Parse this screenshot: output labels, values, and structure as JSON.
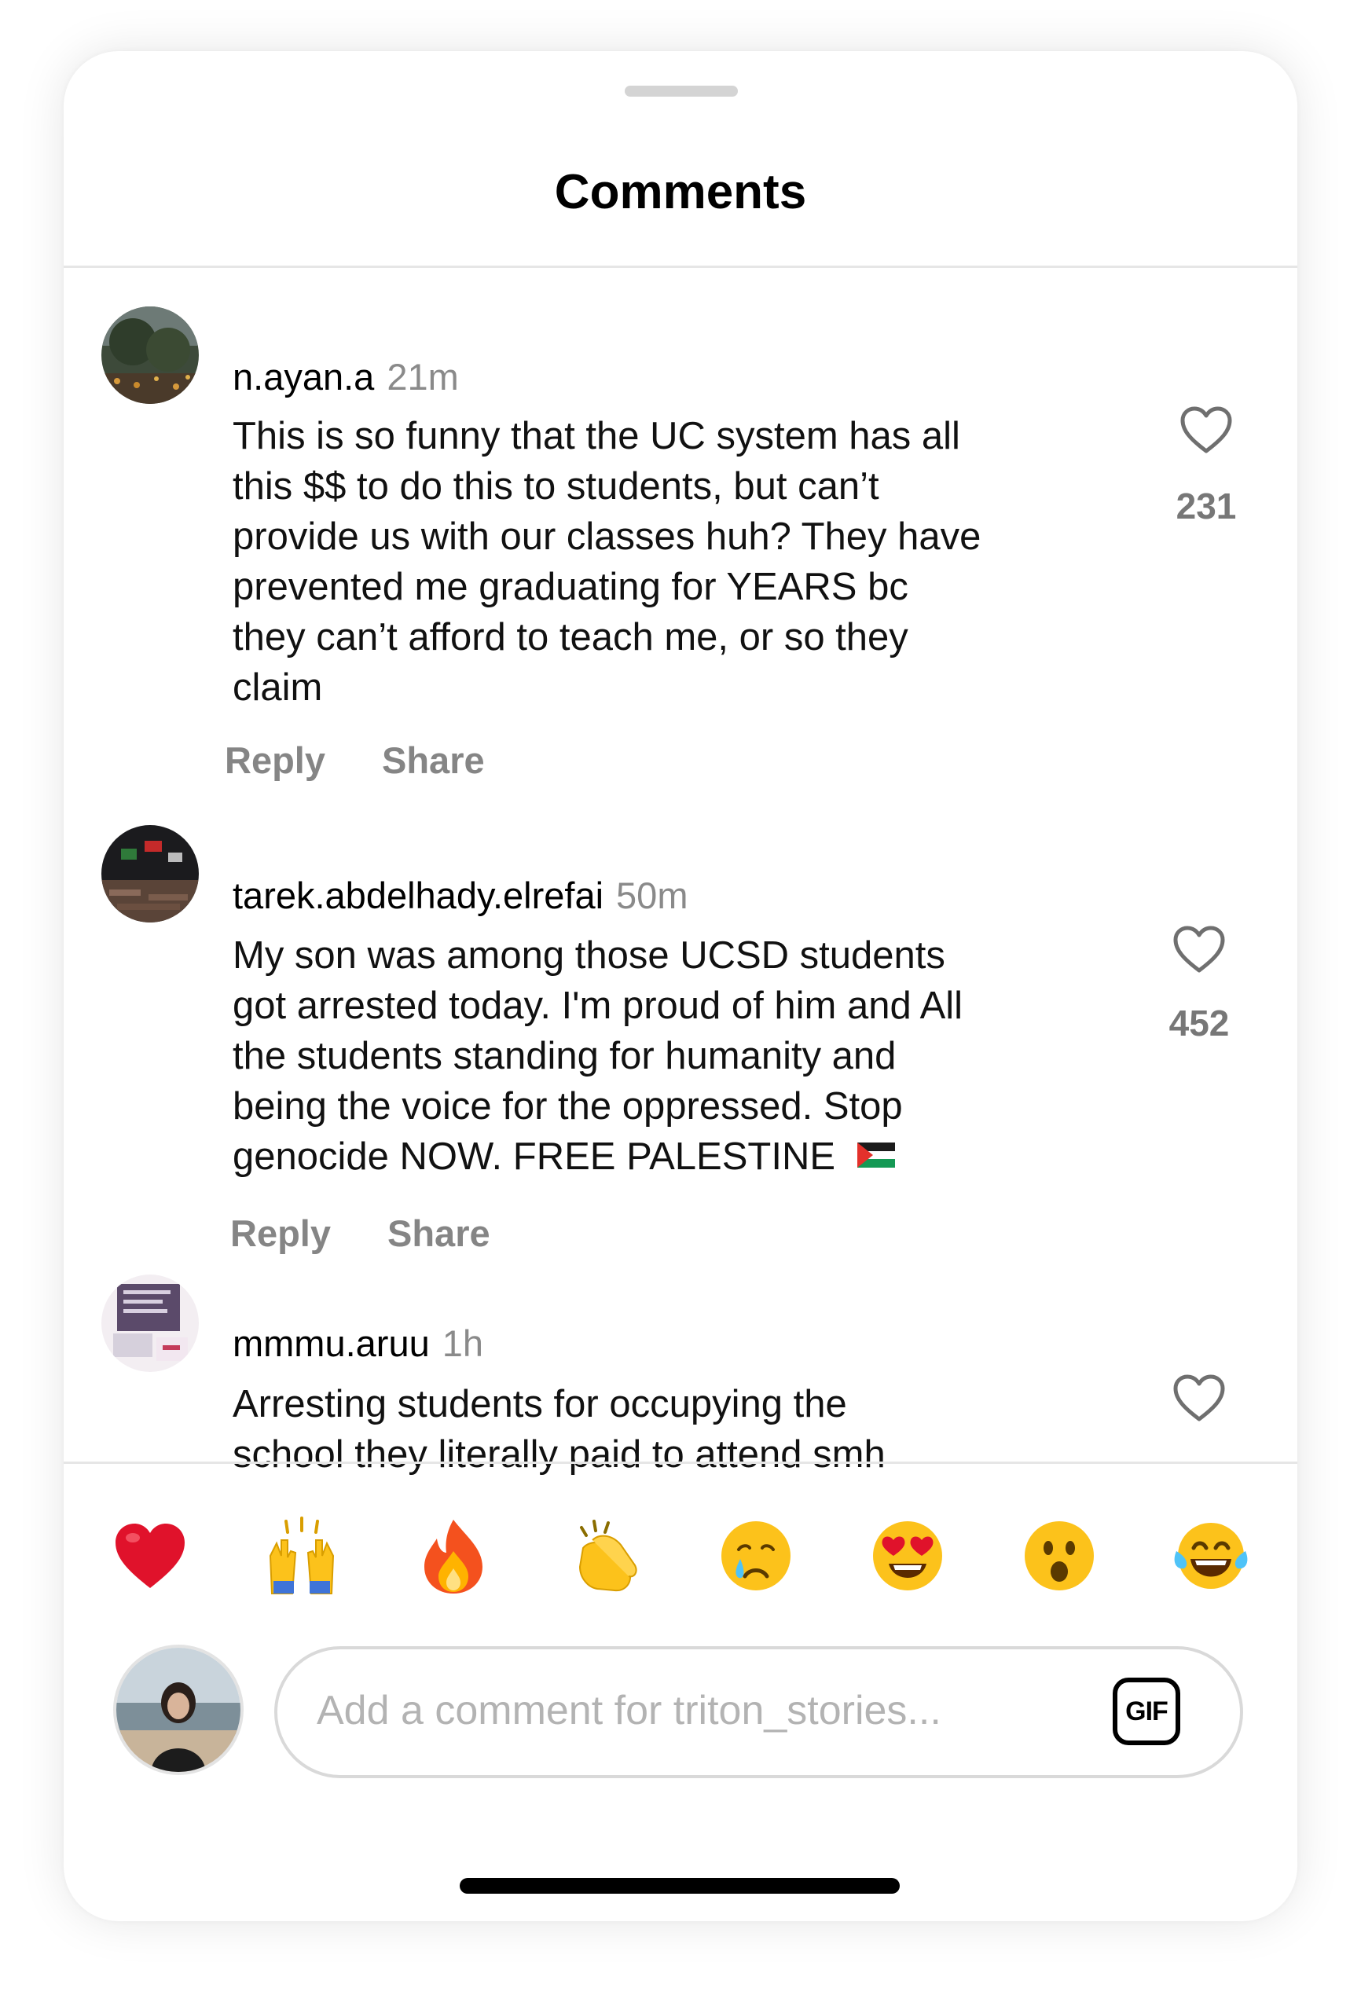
{
  "header": {
    "title": "Comments"
  },
  "comments": [
    {
      "username": "n.ayan.a",
      "time": "21m",
      "lines": [
        "This is so funny that the UC system has all",
        "this $$ to do this to students, but can’t",
        "provide us with our classes huh? They have",
        "prevented me graduating for YEARS bc",
        "they can’t afford to teach me, or so they",
        "claim"
      ],
      "likes": "231",
      "reply_label": "Reply",
      "share_label": "Share"
    },
    {
      "username": "tarek.abdelhady.elrefai",
      "time": "50m",
      "lines": [
        "My son was among those UCSD students",
        "got arrested today. I'm proud of him and All",
        "the students standing for humanity and",
        "being the voice for the oppressed. Stop",
        "genocide NOW. FREE PALESTINE"
      ],
      "likes": "452",
      "reply_label": "Reply",
      "share_label": "Share"
    },
    {
      "username": "mmmu.aruu",
      "time": "1h",
      "lines": [
        "Arresting students for occupying the",
        "school they literally paid to attend smh"
      ]
    }
  ],
  "reactions": [
    "red-heart",
    "raising-hands",
    "fire",
    "clapping-hands",
    "crying-face",
    "heart-eyes",
    "astonished-face",
    "tears-of-joy"
  ],
  "composer": {
    "placeholder": "Add a comment for triton_stories...",
    "gif_label": "GIF"
  },
  "colors": {
    "muted": "#8a8a8a",
    "divider": "#e6e6e6",
    "heart_red": "#e0122b",
    "emoji_yellow": "#fcc21b"
  }
}
